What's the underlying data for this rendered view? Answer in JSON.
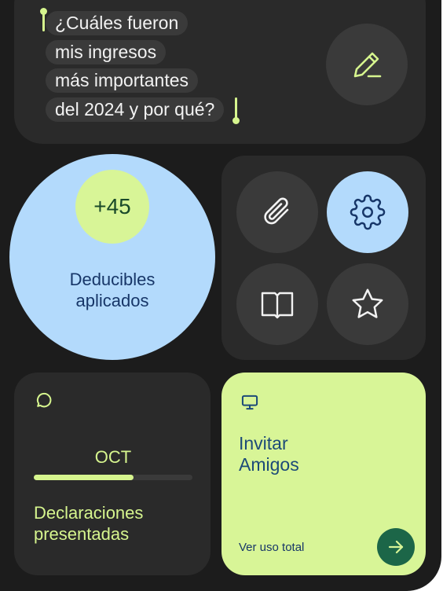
{
  "prompt": {
    "lines": [
      "¿Cuáles fueron",
      "mis ingresos",
      "más importantes",
      "del 2024 y por qué?"
    ],
    "edit_icon": "pencil-icon"
  },
  "deductibles": {
    "count": "+45",
    "label_line1": "Deducibles",
    "label_line2": "aplicados"
  },
  "quick_actions": [
    "paperclip-icon",
    "gear-icon",
    "book-icon",
    "star-icon"
  ],
  "declarations": {
    "icon": "chat-bubble-icon",
    "month": "OCT",
    "progress": 0.63,
    "label_line1": "Declaraciones",
    "label_line2": "presentadas"
  },
  "invite": {
    "icon": "monitor-icon",
    "title_line1": "Invitar",
    "title_line2": "Amigos",
    "link": "Ver uso total",
    "arrow_icon": "arrow-right-icon"
  },
  "colors": {
    "background": "#1c1c1c",
    "card": "#2a2a2a",
    "accent_lime": "#d8f597",
    "accent_blue": "#b3dafc",
    "navy": "#173668",
    "green_button": "#1c6648"
  }
}
